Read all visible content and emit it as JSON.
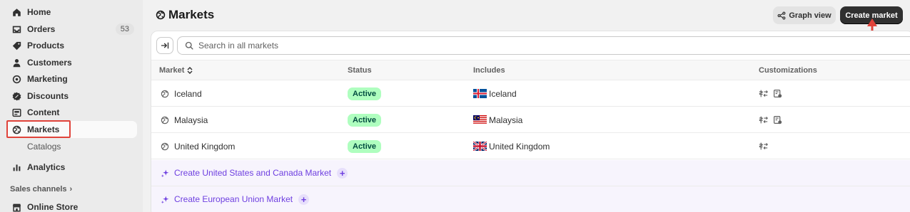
{
  "sidebar": {
    "items": [
      {
        "label": "Home",
        "icon": "home-icon"
      },
      {
        "label": "Orders",
        "icon": "orders-icon",
        "badge": "53"
      },
      {
        "label": "Products",
        "icon": "tag-icon"
      },
      {
        "label": "Customers",
        "icon": "person-icon"
      },
      {
        "label": "Marketing",
        "icon": "target-icon"
      },
      {
        "label": "Discounts",
        "icon": "discount-icon"
      },
      {
        "label": "Content",
        "icon": "content-icon"
      },
      {
        "label": "Markets",
        "icon": "globe-icon"
      },
      {
        "label": "Analytics",
        "icon": "bar-chart-icon"
      }
    ],
    "sub_items": [
      "Catalogs"
    ],
    "sales_channels_label": "Sales channels",
    "online_store_label": "Online Store"
  },
  "header": {
    "title": "Markets",
    "graph_view_label": "Graph view",
    "create_market_label": "Create market"
  },
  "search": {
    "placeholder": "Search in all markets"
  },
  "table": {
    "columns": [
      "Market",
      "Status",
      "Includes",
      "Customizations"
    ],
    "rows": [
      {
        "market": "Iceland",
        "status": "Active",
        "includes": "Iceland",
        "flag": "iceland",
        "customizations": [
          "currency-icon",
          "domain-icon"
        ]
      },
      {
        "market": "Malaysia",
        "status": "Active",
        "includes": "Malaysia",
        "flag": "malaysia",
        "customizations": [
          "currency-icon",
          "domain-icon"
        ]
      },
      {
        "market": "United Kingdom",
        "status": "Active",
        "includes": "United Kingdom",
        "flag": "uk",
        "customizations": [
          "currency-icon"
        ]
      }
    ],
    "suggestions": [
      {
        "label": "Create United States and Canada Market"
      },
      {
        "label": "Create European Union Market"
      }
    ]
  },
  "colors": {
    "status_active_bg": "#affebf",
    "suggestion_text": "#6e3fe0",
    "primary_button": "#303030",
    "highlight": "#e0433a"
  }
}
